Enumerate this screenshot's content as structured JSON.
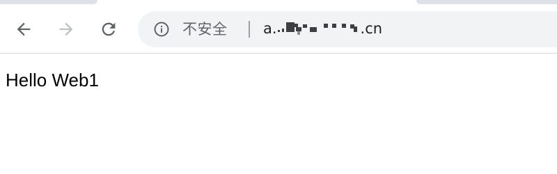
{
  "toolbar": {
    "omnibox": {
      "security_label": "不安全",
      "url_prefix": "a.",
      "url_suffix": ".cn"
    }
  },
  "page": {
    "body_text": "Hello Web1"
  },
  "colors": {
    "toolbar_bg": "#ffffff",
    "omnibox_bg": "#f1f3f4",
    "icon_active": "#5f6368",
    "icon_disabled": "#bdc1c6",
    "security_text": "#5f6368",
    "url_text": "#202124",
    "page_text": "#000000"
  },
  "icons": {
    "back": "arrow-left-icon",
    "forward": "arrow-right-icon",
    "reload": "reload-icon",
    "security": "info-circle-icon"
  }
}
